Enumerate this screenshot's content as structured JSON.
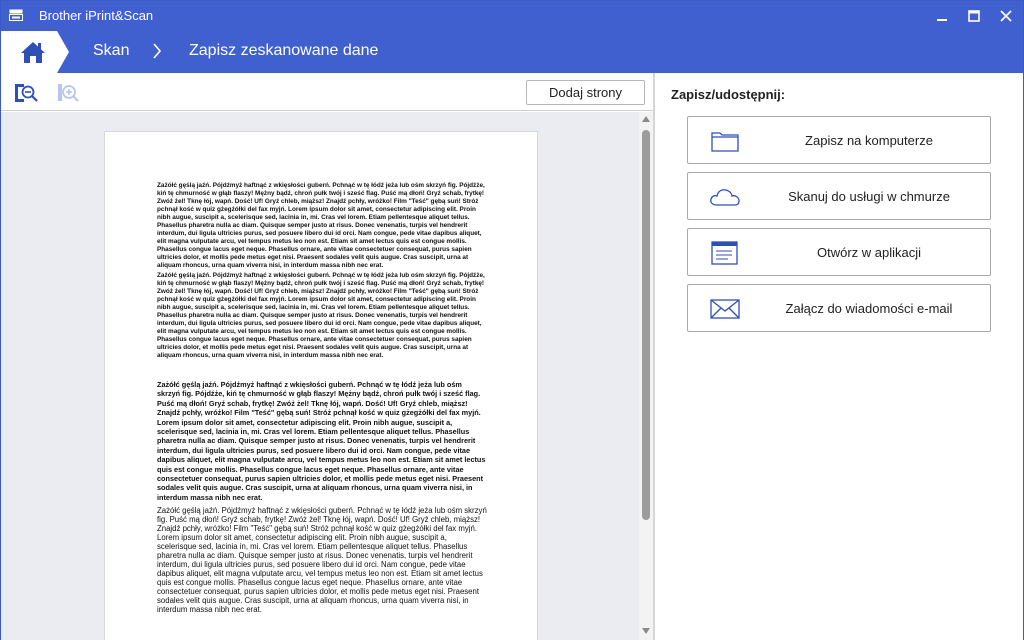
{
  "window": {
    "title": "Brother iPrint&Scan",
    "accent": "#4060cf"
  },
  "breadcrumb": {
    "items": [
      "Skan",
      "Zapisz zeskanowane dane"
    ]
  },
  "toolbar": {
    "zoom_out_icon": "zoom-out-icon",
    "zoom_in_icon": "zoom-in-icon",
    "add_pages_label": "Dodaj strony"
  },
  "document": {
    "paragraphs": [
      "Zażółć gęślą jaźń. Pójdźmyż haftnąć z wkięsłości guberń. Pchnąć w tę łódź jeża lub ośm skrzyń fig. Pójdźże, kiń tę chmurność w głąb flaszy! Mężny bądź, chroń pułk twój i sześć flag. Puść mą dłoń! Gryź schab, frytkę! Zwóż żel! Tknę łój, wapń. Dość! Uf! Gryź chleb, miąższ! Znajdź pchły, wróżko! Film \"Teść\" gębą suń! Stróż pchnął kość w quiz gżegżółki del fax myjń. Lorem ipsum dolor sit amet, consectetur adipiscing elit. Proin nibh augue, suscipit a, scelerisque sed, lacinia in, mi. Cras vel lorem. Etiam pellentesque aliquet tellus. Phasellus pharetra nulla ac diam. Quisque semper justo at risus. Donec venenatis, turpis vel hendrerit interdum, dui ligula ultricies purus, sed posuere libero dui id orci. Nam congue, pede vitae dapibus aliquet, elit magna vulputate arcu, vel tempus metus leo non est. Etiam sit amet lectus quis est congue mollis. Phasellus congue lacus eget neque. Phasellus ornare, ante vitae consectetuer consequat, purus sapien ultricies dolor, et mollis pede metus eget nisi. Praesent sodales velit quis augue. Cras suscipit, urna at aliquam rhoncus, urna quam viverra nisi, in interdum massa nibh nec erat.",
      "Zażółć gęślą jaźń. Pójdźmyż haftnąć z wkięsłości guberń. Pchnąć w tę łódź jeża lub ośm skrzyń fig. Pójdźże, kiń tę chmurność w głąb flaszy! Mężny bądź, chroń pułk twój i sześć flag. Puść mą dłoń! Gryź schab, frytkę! Zwóż żel! Tknę łój, wapń. Dość! Uf! Gryź chleb, miąższ! Znajdź pchły, wróżko! Film \"Teść\" gębą suń! Stróż pchnął kość w quiz gżegżółki del fax myjń. Lorem ipsum dolor sit amet, consectetur adipiscing elit. Proin nibh augue, suscipit a, scelerisque sed, lacinia in, mi. Cras vel lorem. Etiam pellentesque aliquet tellus. Phasellus pharetra nulla ac diam. Quisque semper justo at risus. Donec venenatis, turpis vel hendrerit interdum, dui ligula ultricies purus, sed posuere libero dui id orci. Nam congue, pede vitae dapibus aliquet, elit magna vulputate arcu, vel tempus metus leo non est. Etiam sit amet lectus quis est congue mollis. Phasellus congue lacus eget neque. Phasellus ornare, ante vitae consectetuer consequat, purus sapien ultricies dolor, et mollis pede metus eget nisi. Praesent sodales velit quis augue. Cras suscipit, urna at aliquam rhoncus, urna quam viverra nisi, in interdum massa nibh nec erat.",
      "Zażółć gęślą jaźń. Pójdźmyż haftnąć z wkięsłości guberń. Pchnąć w tę łódź jeża lub ośm skrzyń fig. Pójdźże, kiń tę chmurność w głąb flaszy! Mężny bądź, chroń pułk twój i sześć flag. Puść mą dłoń! Gryź schab, frytkę! Zwóż żel! Tknę łój, wapń. Dość! Uf! Gryź chleb, miąższ! Znajdź pchły, wróżko! Film \"Teść\" gębą suń! Stróż pchnął kość w quiz gżegżółki del fax myjń. Lorem ipsum dolor sit amet, consectetur adipiscing elit. Proin nibh augue, suscipit a, scelerisque sed, lacinia in, mi. Cras vel lorem. Etiam pellentesque aliquet tellus. Phasellus pharetra nulla ac diam. Quisque semper justo at risus. Donec venenatis, turpis vel hendrerit interdum, dui ligula ultricies purus, sed posuere libero dui id orci. Nam congue, pede vitae dapibus aliquet, elit magna vulputate arcu, vel tempus metus leo non est. Etiam sit amet lectus quis est congue mollis. Phasellus congue lacus eget neque. Phasellus ornare, ante vitae consectetuer consequat, purus sapien ultricies dolor, et mollis pede metus eget nisi. Praesent sodales velit quis augue. Cras suscipit, urna at aliquam rhoncus, urna quam viverra nisi, in interdum massa nibh nec erat.",
      "Zażółć gęślą jaźń. Pójdźmyż haftnąć z wkięsłości guberń. Pchnąć w tę łódź jeża lub ośm skrzyń fig. Puść mą dłoń! Gryź schab, frytkę! Zwóż żel! Tknę łój, wapń. Dość! Uf! Gryź chleb, miąższ! Znajdź pchły, wróżko! Film \"Teść\" gębą suń! Stróż pchnął kość w quiz gżegżółki del fax myjń. Lorem ipsum dolor sit amet, consectetur adipiscing elit. Proin nibh augue, suscipit a, scelerisque sed, lacinia in, mi. Cras vel lorem. Etiam pellentesque aliquet tellus. Phasellus pharetra nulla ac diam. Quisque semper justo at risus. Donec venenatis, turpis vel hendrerit interdum, dui ligula ultricies purus, sed posuere libero dui id orci. Nam congue, pede vitae dapibus aliquet, elit magna vulputate arcu, vel tempus metus leo non est. Etiam sit amet lectus quis est congue mollis. Phasellus congue lacus eget neque. Phasellus ornare, ante vitae consectetuer consequat, purus sapien ultricies dolor, et mollis pede metus eget nisi. Praesent sodales velit quis augue. Cras suscipit, urna at aliquam rhoncus, urna quam viverra nisi, in interdum massa nibh nec erat."
    ]
  },
  "panel": {
    "title": "Zapisz/udostępnij:",
    "actions": [
      {
        "label": "Zapisz na komputerze",
        "icon": "folder-icon"
      },
      {
        "label": "Skanuj do usługi w chmurze",
        "icon": "cloud-icon"
      },
      {
        "label": "Otwórz w aplikacji",
        "icon": "app-window-icon"
      },
      {
        "label": "Załącz do wiadomości e-mail",
        "icon": "envelope-icon"
      }
    ]
  }
}
